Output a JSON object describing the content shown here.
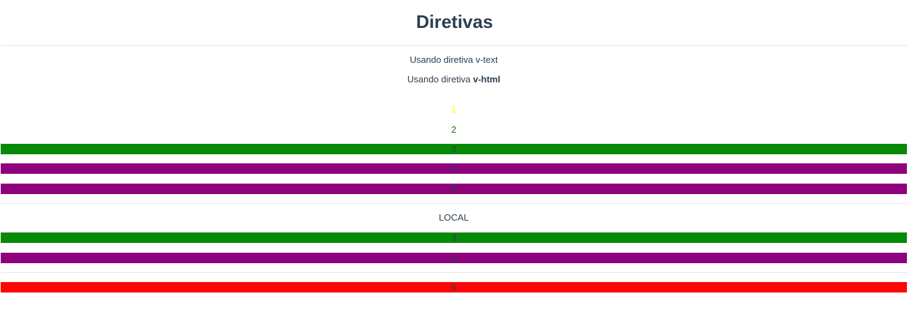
{
  "page": {
    "title": "Diretivas"
  },
  "directives": {
    "v_text": "Usando diretiva v-text",
    "v_html_prefix": "Usando diretiva ",
    "v_html_bold": "v-html"
  },
  "global_items": [
    {
      "label": "1",
      "text_color": "#ffff00",
      "background": ""
    },
    {
      "label": "2",
      "text_color": "#008000",
      "background": ""
    },
    {
      "label": "3",
      "text_color": "#2c3e50",
      "background": "#078a07"
    },
    {
      "label": "4",
      "text_color": "#2c3e50",
      "background": "#8e027e"
    },
    {
      "label": "5",
      "text_color": "#2c3e50",
      "background": "#8e027e"
    }
  ],
  "local": {
    "heading": "LOCAL",
    "items": [
      {
        "label": "3",
        "text_color": "#2c3e50",
        "background": "#078a07"
      },
      {
        "label": "4",
        "text_color": "#2c3e50",
        "background": "#8e027e"
      }
    ]
  },
  "extra_items": [
    {
      "label": "6",
      "text_color": "#2c3e50",
      "background": "#ff0606"
    }
  ]
}
